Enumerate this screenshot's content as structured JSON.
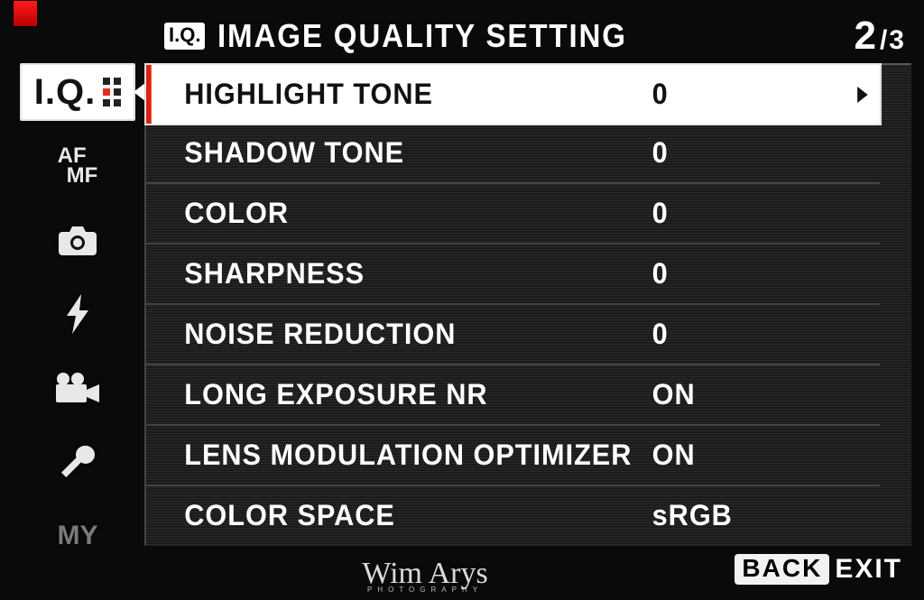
{
  "header": {
    "iq_badge": "I.Q.",
    "title": "IMAGE QUALITY SETTING",
    "page_current": "2",
    "page_total": "/3"
  },
  "sidebar": {
    "items": [
      {
        "id": "iq",
        "label": "I.Q.",
        "active": true
      },
      {
        "id": "afmf",
        "label": "AF MF"
      },
      {
        "id": "camera",
        "label": "camera-icon"
      },
      {
        "id": "flash",
        "label": "flash-icon"
      },
      {
        "id": "movie",
        "label": "movie-icon"
      },
      {
        "id": "setup",
        "label": "wrench-icon"
      },
      {
        "id": "my",
        "label": "MY"
      }
    ]
  },
  "menu": {
    "items": [
      {
        "label": "HIGHLIGHT TONE",
        "value": "0",
        "selected": true
      },
      {
        "label": "SHADOW TONE",
        "value": "0"
      },
      {
        "label": "COLOR",
        "value": "0"
      },
      {
        "label": "SHARPNESS",
        "value": "0"
      },
      {
        "label": "NOISE REDUCTION",
        "value": "0"
      },
      {
        "label": "LONG EXPOSURE NR",
        "value": "ON"
      },
      {
        "label": "LENS MODULATION OPTIMIZER",
        "value": "ON"
      },
      {
        "label": "COLOR SPACE",
        "value": "sRGB"
      }
    ]
  },
  "footer": {
    "back_label": "BACK",
    "exit_label": "EXIT"
  },
  "watermark": {
    "name": "Wim Arys",
    "sub": "PHOTOGRAPHY"
  }
}
